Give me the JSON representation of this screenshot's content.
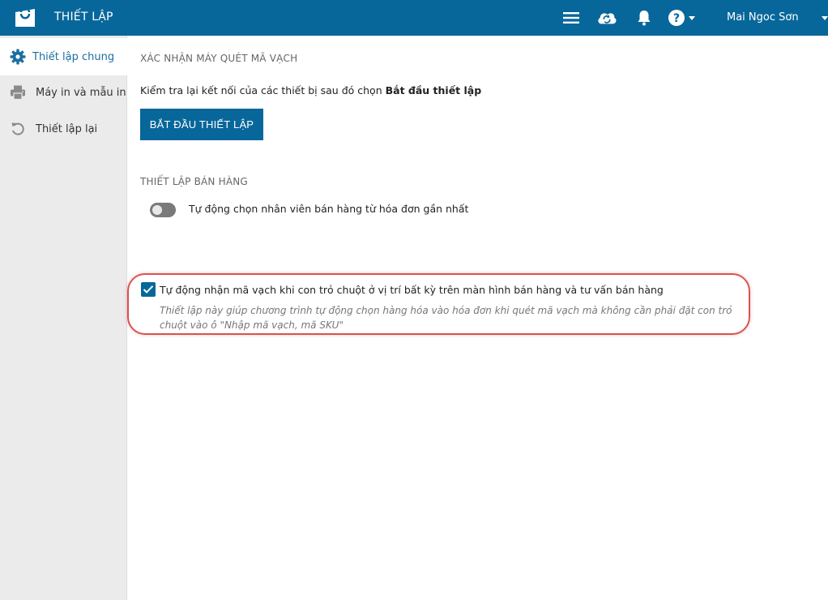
{
  "header": {
    "app_title": "THIẾT LẬP",
    "user_name": "Mai Ngoc Sơn",
    "icons": [
      "shopping-bag-icon",
      "menu-icon",
      "cloud-sync-icon",
      "bell-icon",
      "help-icon"
    ]
  },
  "sidebar": {
    "items": [
      {
        "label": "Thiết lập chung",
        "icon": "gear-icon",
        "active": true
      },
      {
        "label": "Máy in và mẫu in",
        "icon": "printer-icon",
        "active": false
      },
      {
        "label": "Thiết lập lại",
        "icon": "reset-icon",
        "active": false
      }
    ]
  },
  "scanner": {
    "title": "XÁC NHẬN MÁY QUÉT MÃ VẠCH",
    "hint_prefix": "Kiểm tra lại kết nối của các thiết bị sau đó chọn ",
    "hint_bold": "Bắt đầu thiết lập",
    "button_label": "BẮT ĐẦU THIẾT LẬP"
  },
  "sales": {
    "title": "THIẾT LẬP BÁN HÀNG",
    "toggle_label": "Tự động chọn nhân viên bán hàng từ hóa đơn gần nhất",
    "toggle_on": false,
    "checkbox_label": "Tự động nhận mã vạch khi con trỏ chuột ở vị trí bất kỳ trên màn hình bán hàng và tư vấn bán hàng",
    "checkbox_checked": true,
    "checkbox_desc": "Thiết lập này giúp chương trình tự động chọn hàng hóa vào hóa đơn khi quét mã vạch mà không cần phải đặt con trỏ chuột vào ô \"Nhập mã vạch, mã SKU\""
  },
  "colors": {
    "primary": "#07679a",
    "sidebar_bg": "#ebebeb",
    "highlight": "#d9534f"
  }
}
